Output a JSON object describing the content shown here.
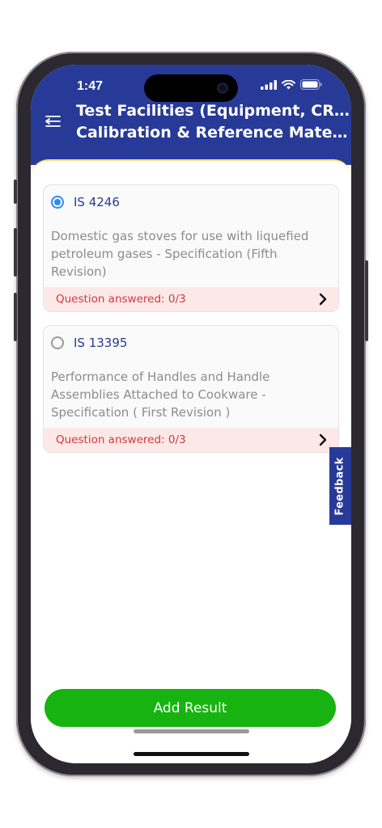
{
  "status_bar": {
    "time": "1:47"
  },
  "header": {
    "title_line1": "Test Facilities (Equipment, CRM,",
    "title_line2": "Calibration & Reference Materia..."
  },
  "standards": [
    {
      "code": "IS 4246",
      "selected": true,
      "description": "Domestic gas stoves for use with liquefied petroleum gases - Specification (Fifth Revision)",
      "progress_text": "Question answered: 0/3"
    },
    {
      "code": "IS 13395",
      "selected": false,
      "description": "Performance of Handles and Handle Assemblies Attached to Cookware - Specification ( First Revision )",
      "progress_text": "Question answered: 0/3"
    }
  ],
  "feedback_tab": {
    "label": "Feedback"
  },
  "actions": {
    "add_result_label": "Add Result"
  },
  "colors": {
    "header_bg": "#283a97",
    "accent_blue": "#2b8ef0",
    "answered_text": "#d23b3b",
    "answered_bg": "#fde8e8",
    "primary_button": "#17b310"
  },
  "icons": {
    "menu": "menu-back-icon",
    "signal": "signal-icon",
    "wifi": "wifi-icon",
    "battery": "battery-icon",
    "chevron": "chevron-right-icon"
  }
}
